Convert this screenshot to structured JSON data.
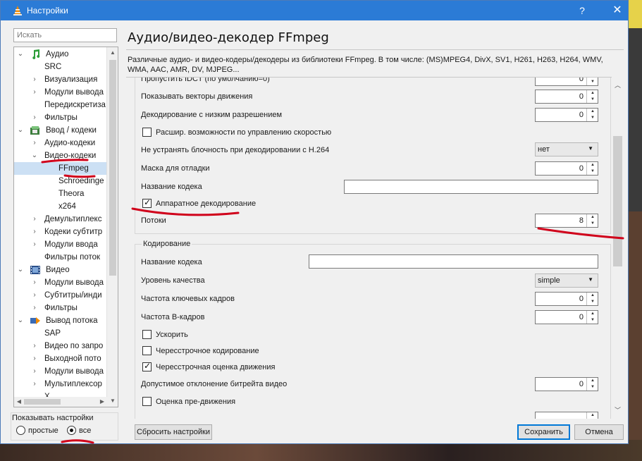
{
  "window": {
    "title": "Настройки",
    "help_label": "?",
    "close_label": "✕"
  },
  "search": {
    "placeholder": "Искать"
  },
  "tree": {
    "items": [
      {
        "label": "Аудио"
      },
      {
        "label": "SRC"
      },
      {
        "label": "Визуализация"
      },
      {
        "label": "Модули вывода"
      },
      {
        "label": "Передискретиза"
      },
      {
        "label": "Фильтры"
      },
      {
        "label": "Ввод / кодеки"
      },
      {
        "label": "Аудио-кодеки"
      },
      {
        "label": "Видео-кодеки"
      },
      {
        "label": "FFmpeg"
      },
      {
        "label": "Schroedinge"
      },
      {
        "label": "Theora"
      },
      {
        "label": "x264"
      },
      {
        "label": "Демультиплекс"
      },
      {
        "label": "Кодеки субтитр"
      },
      {
        "label": "Модули ввода"
      },
      {
        "label": "Фильтры поток"
      },
      {
        "label": "Видео"
      },
      {
        "label": "Модули вывода"
      },
      {
        "label": "Субтитры/инди"
      },
      {
        "label": "Фильтры"
      },
      {
        "label": "Вывод потока"
      },
      {
        "label": "SAP"
      },
      {
        "label": "Видео по запро"
      },
      {
        "label": "Выходной пото"
      },
      {
        "label": "Модули вывода"
      },
      {
        "label": "Мультиплексор"
      },
      {
        "label": "Х"
      }
    ]
  },
  "show_settings": {
    "label": "Показывать настройки",
    "simple": "простые",
    "all": "все",
    "selected": "все"
  },
  "main": {
    "heading": "Аудио/видео-декодер FFmpeg",
    "description": "Различные аудио- и видео-кодеры/декодеры из библиотеки FFmpeg. В том числе: (MS)MPEG4, DivX, SV1, H261, H263, H264, WMV, WMA, AAC, AMR, DV, MJPEG..."
  },
  "decoding": {
    "skip_idct_label": "Пропустить IDCT (по умолчанию=0)",
    "skip_idct_value": "0",
    "motion_vectors_label": "Показывать векторы движения",
    "motion_vectors_value": "0",
    "lowres_label": "Декодирование с низким разрешением",
    "lowres_value": "0",
    "fast_label": "Расшир. возможности по управлению скоростью",
    "fast_checked": false,
    "skiploopfilter_label": "Не устранять блочность при декодировании с H.264",
    "skiploopfilter_value": "нет",
    "debug_mask_label": "Маска для отладки",
    "debug_mask_value": "0",
    "codec_name_label": "Название кодека",
    "codec_name_value": "",
    "hw_label": "Аппаратное декодирование",
    "hw_checked": true,
    "threads_label": "Потоки",
    "threads_value": "8"
  },
  "encoding": {
    "group_title": "Кодирование",
    "codec_name_label": "Название кодека",
    "codec_name_value": "",
    "quality_label": "Уровень качества",
    "quality_value": "simple",
    "keyframes_label": "Частота ключевых кадров",
    "keyframes_value": "0",
    "bframes_label": "Частота B-кадров",
    "bframes_value": "0",
    "hurry_label": "Ускорить",
    "hurry_checked": false,
    "interlace_label": "Чересстрочное кодирование",
    "interlace_checked": false,
    "interlace_me_label": "Чересстрочная оценка движения",
    "interlace_me_checked": true,
    "tolerance_label": "Допустимое отклонение битрейта видео",
    "tolerance_value": "0",
    "pre_me_label": "Оценка пре-движения",
    "pre_me_checked": false
  },
  "buttons": {
    "reset": "Сбросить настройки",
    "save": "Сохранить",
    "cancel": "Отмена"
  },
  "annotation_color": "#d0021b"
}
